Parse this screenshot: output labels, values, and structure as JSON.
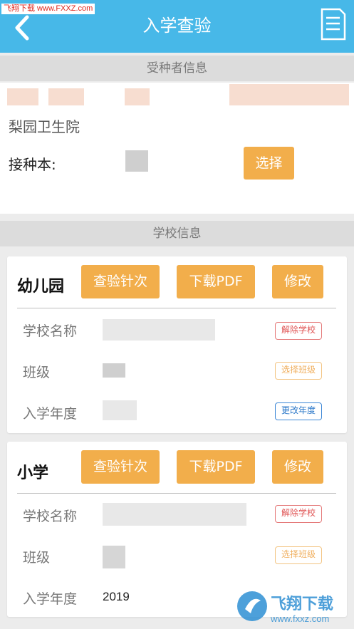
{
  "watermark": {
    "text": "飞翔下载 www.FXXZ.com"
  },
  "header": {
    "title": "入学查验",
    "back_icon": "back-arrow-icon",
    "doc_icon": "document-list-icon",
    "color": "#47b8e8"
  },
  "recipient_section": {
    "title": "受种者信息",
    "hospital": "梨园卫生院",
    "vaccine_book_label": "接种本:",
    "select_button": "选择"
  },
  "school_section": {
    "title": "学校信息"
  },
  "cards": [
    {
      "title": "幼儿园",
      "buttons": {
        "check": "查验针次",
        "download": "下载PDF",
        "modify": "修改"
      },
      "fields": {
        "school_name_label": "学校名称",
        "class_label": "班级",
        "year_label": "入学年度",
        "year_value": ""
      },
      "actions": {
        "remove_school": "解除学校",
        "select_class": "选择班级",
        "change_year": "更改年度"
      }
    },
    {
      "title": "小学",
      "buttons": {
        "check": "查验针次",
        "download": "下载PDF",
        "modify": "修改"
      },
      "fields": {
        "school_name_label": "学校名称",
        "class_label": "班级",
        "year_label": "入学年度",
        "year_value": "2019"
      },
      "actions": {
        "remove_school": "解除学校",
        "select_class": "选择班级"
      }
    }
  ],
  "bottom_watermark": {
    "text_main": "飞翔下载",
    "text_url": "www.fxxz.com"
  },
  "colors": {
    "accent": "#f2ae4b",
    "red": "#e05555",
    "blue": "#2b78c9"
  }
}
